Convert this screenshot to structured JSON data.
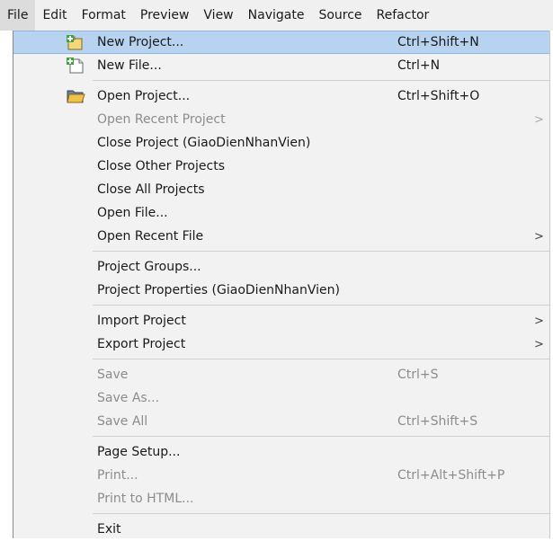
{
  "menubar": {
    "items": [
      "File",
      "Edit",
      "Format",
      "Preview",
      "View",
      "Navigate",
      "Source",
      "Refactor"
    ]
  },
  "file_menu": {
    "new_project": {
      "label": "New Project...",
      "shortcut": "Ctrl+Shift+N",
      "icon": "new-project-icon"
    },
    "new_file": {
      "label": "New File...",
      "shortcut": "Ctrl+N",
      "icon": "new-file-icon"
    },
    "open_project": {
      "label": "Open Project...",
      "shortcut": "Ctrl+Shift+O",
      "icon": "open-project-icon"
    },
    "open_recent_project": {
      "label": "Open Recent Project",
      "arrow": ">"
    },
    "close_project": {
      "label": "Close Project (GiaoDienNhanVien)"
    },
    "close_other_projects": {
      "label": "Close Other Projects"
    },
    "close_all_projects": {
      "label": "Close All Projects"
    },
    "open_file": {
      "label": "Open File..."
    },
    "open_recent_file": {
      "label": "Open Recent File",
      "arrow": ">"
    },
    "project_groups": {
      "label": "Project Groups..."
    },
    "project_properties": {
      "label": "Project Properties (GiaoDienNhanVien)"
    },
    "import_project": {
      "label": "Import Project",
      "arrow": ">"
    },
    "export_project": {
      "label": "Export Project",
      "arrow": ">"
    },
    "save": {
      "label": "Save",
      "shortcut": "Ctrl+S"
    },
    "save_as": {
      "label": "Save As..."
    },
    "save_all": {
      "label": "Save All",
      "shortcut": "Ctrl+Shift+S"
    },
    "page_setup": {
      "label": "Page Setup..."
    },
    "print": {
      "label": "Print...",
      "shortcut": "Ctrl+Alt+Shift+P"
    },
    "print_to_html": {
      "label": "Print to HTML..."
    },
    "exit": {
      "label": "Exit"
    }
  },
  "colors": {
    "highlight": "#b8d3f0",
    "disabled_text": "#8c8c8c",
    "menu_background": "#f2f2f2"
  }
}
